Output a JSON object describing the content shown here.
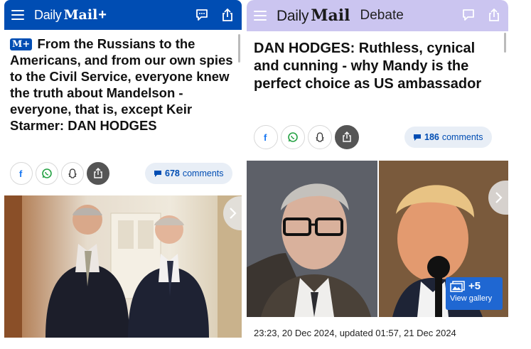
{
  "left": {
    "logo_text": "Daily",
    "logo_bold": "Mail",
    "logo_plus": "+",
    "badge": "M+",
    "headline": "From the Russians to the Americans, and from our own spies to the Civil Service, everyone knew the truth about Mandelson - everyone, that is, except Keir Starmer: DAN HODGES",
    "comment_count": "678",
    "comment_label": "comments"
  },
  "right": {
    "logo_text": "Daily",
    "logo_bold": "Mail",
    "section": "Debate",
    "headline": "DAN HODGES: Ruthless, cynical and cunning - why Mandy is the perfect choice as US ambassador",
    "comment_count": "186",
    "comment_label": "comments",
    "gallery_count": "+5",
    "gallery_label": "View gallery",
    "timestamp": "23:23, 20 Dec 2024, updated 01:57, 21 Dec 2024"
  },
  "icons": [
    "menu-icon",
    "comment-icon",
    "share-icon",
    "facebook-icon",
    "whatsapp-icon",
    "snapchat-icon",
    "share-icon",
    "chevron-right-icon",
    "gallery-icon"
  ],
  "colors": {
    "left_header": "#004db3",
    "right_header": "#cbc5f0",
    "accent": "#004db3",
    "gallery": "#1f67d2"
  }
}
